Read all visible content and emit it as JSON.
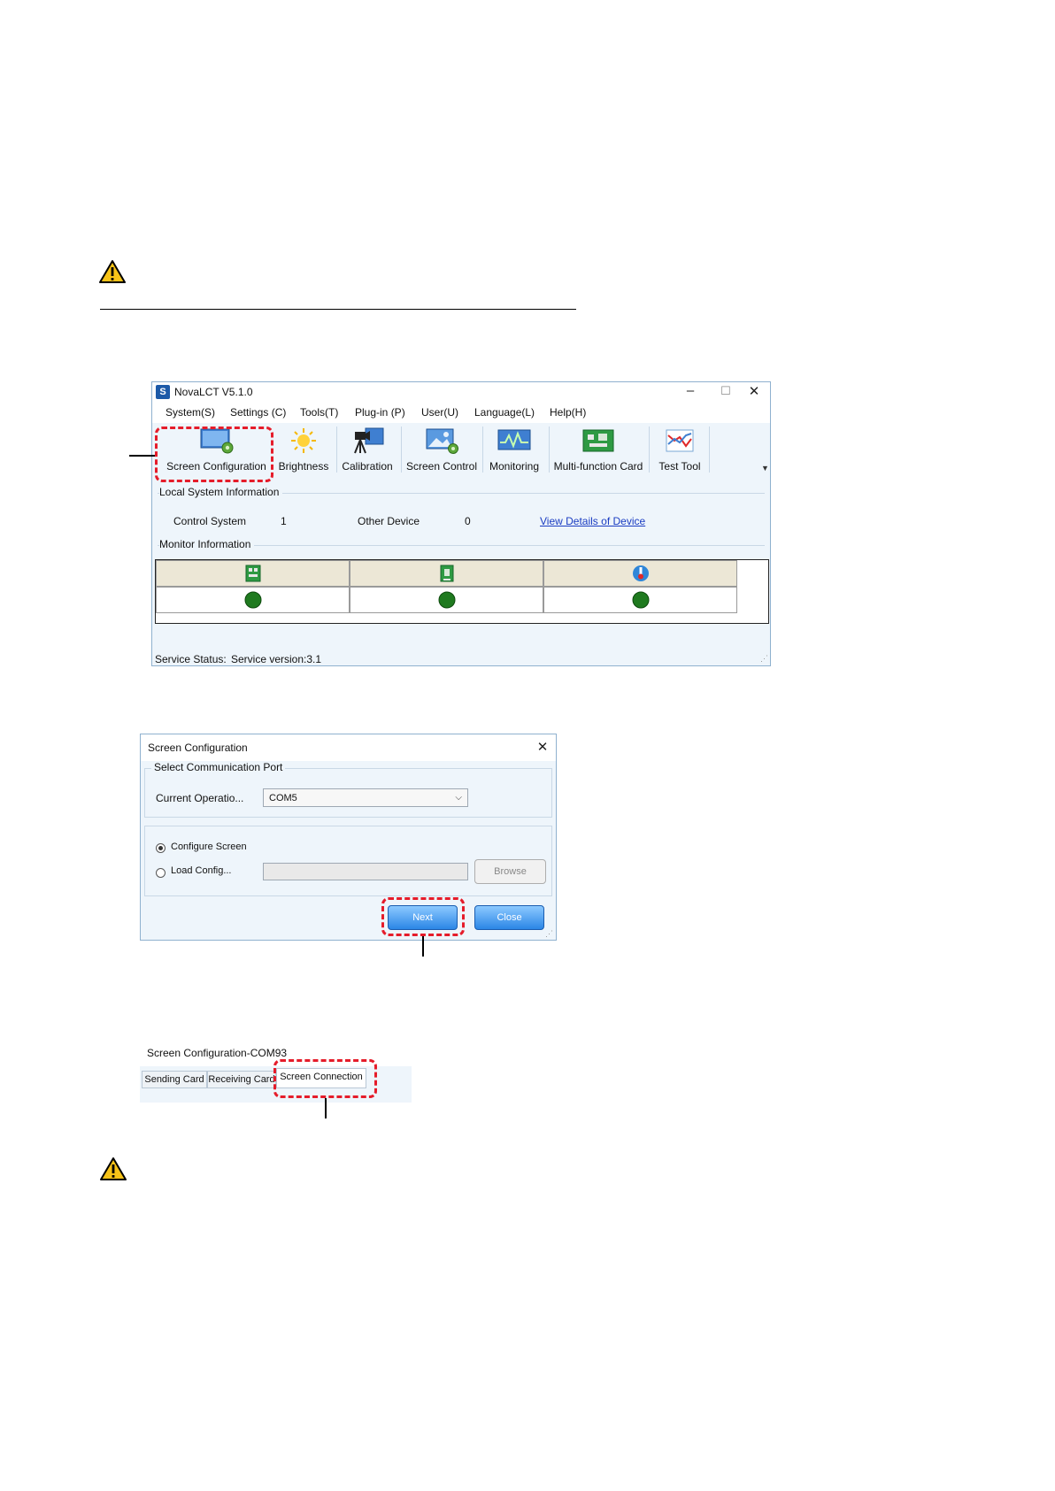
{
  "novalct": {
    "title": "NovaLCT V5.1.0",
    "menu": [
      "System(S)",
      "Settings (C)",
      "Tools(T)",
      "Plug-in (P)",
      "User(U)",
      "Language(L)",
      "Help(H)"
    ],
    "toolbar": [
      "Screen Configuration",
      "Brightness",
      "Calibration",
      "Screen Control",
      "Monitoring",
      "Multi-function Card",
      "Test Tool"
    ],
    "local_system_info": {
      "caption": "Local System Information",
      "control_system_label": "Control System",
      "control_system_value": "1",
      "other_device_label": "Other Device",
      "other_device_value": "0",
      "view_details_link": "View Details of Device"
    },
    "monitor_info": {
      "caption": "Monitor Information"
    },
    "status_bar": {
      "label": "Service Status:",
      "value": "Service version:3.1"
    }
  },
  "screen_config_dialog": {
    "title": "Screen Configuration",
    "port_group": "Select Communication Port",
    "current_operation_label": "Current Operatio...",
    "port_value": "COM5",
    "configure_screen_label": "Configure Screen",
    "load_config_label": "Load Config...",
    "browse_label": "Browse",
    "next_label": "Next",
    "close_label": "Close"
  },
  "tabs_window": {
    "title": "Screen Configuration-COM93",
    "tabs": [
      "Sending Card",
      "Receiving Card",
      "Screen Connection"
    ]
  },
  "colors": {
    "highlight": "#e51c2a",
    "link": "#1a3cc2",
    "status_ok": "#1f7a1f"
  }
}
